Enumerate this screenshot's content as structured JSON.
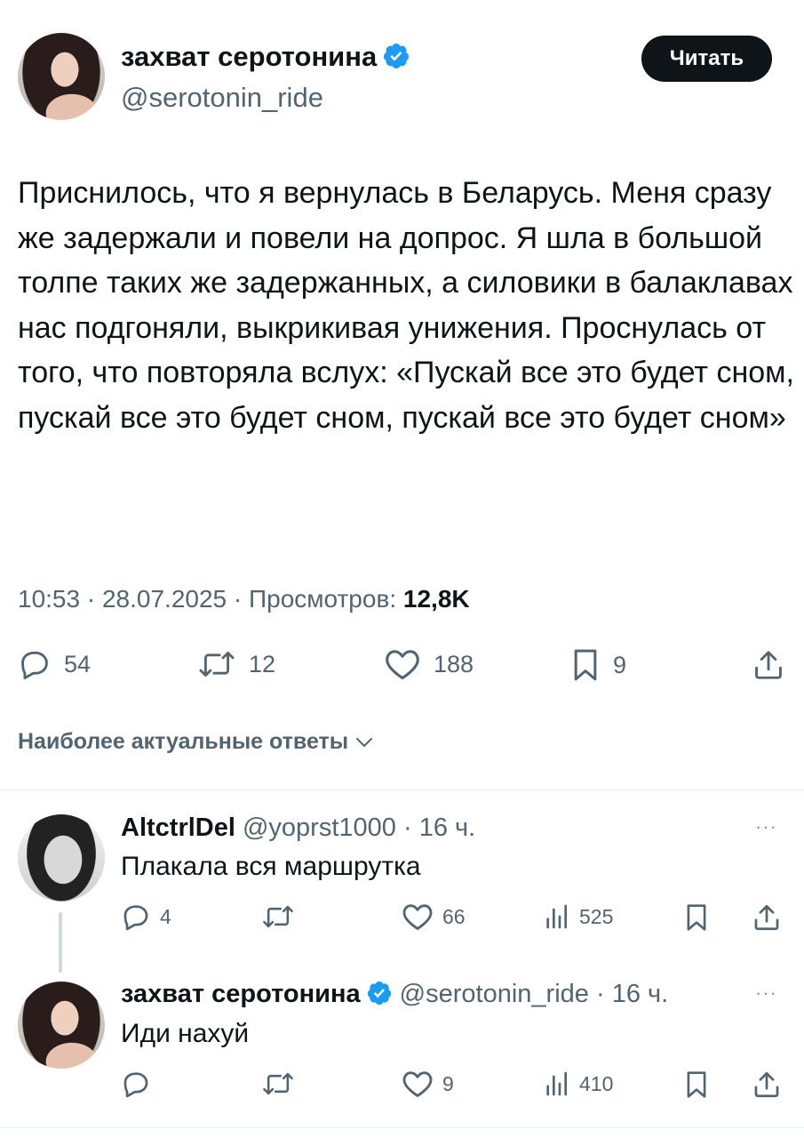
{
  "tweet": {
    "author_name": "захват серотонина",
    "author_handle": "@serotonin_ride",
    "follow_label": "Читать",
    "text": "Приснилось, что я вернулась в Беларусь. Меня сразу же задержали и повели на допрос. Я шла в большой толпе таких же задержанных, а силовики в балаклавах нас подгоняли, выкрикивая унижения. Проснулась от того, что повторяла вслух: «Пускай все это будет сном, пускай все это будет сном, пускай все это будет сном»",
    "time": "10:53",
    "date": "28.07.2025",
    "views_label": "Просмотров:",
    "views_count": "12,8K",
    "replies": "54",
    "retweets": "12",
    "likes": "188",
    "bookmarks": "9"
  },
  "replies_section": {
    "sort_label": "Наиболее актуальные ответы"
  },
  "replies": [
    {
      "name": "AltctrlDel",
      "handle": "@yoprst1000",
      "time": "16 ч.",
      "text": "Плакала вся маршрутка",
      "replies": "4",
      "retweets": "",
      "likes": "66",
      "views": "525"
    },
    {
      "name": "захват серотонина",
      "handle": "@serotonin_ride",
      "time": "16 ч.",
      "text": "Иди нахуй",
      "replies": "",
      "retweets": "",
      "likes": "9",
      "views": "410"
    }
  ],
  "colors": {
    "verified": "#1d9bf0",
    "text": "#0f1419",
    "secondary": "#536471",
    "button": "#0f1419"
  },
  "separators": {
    "dot": "·"
  }
}
